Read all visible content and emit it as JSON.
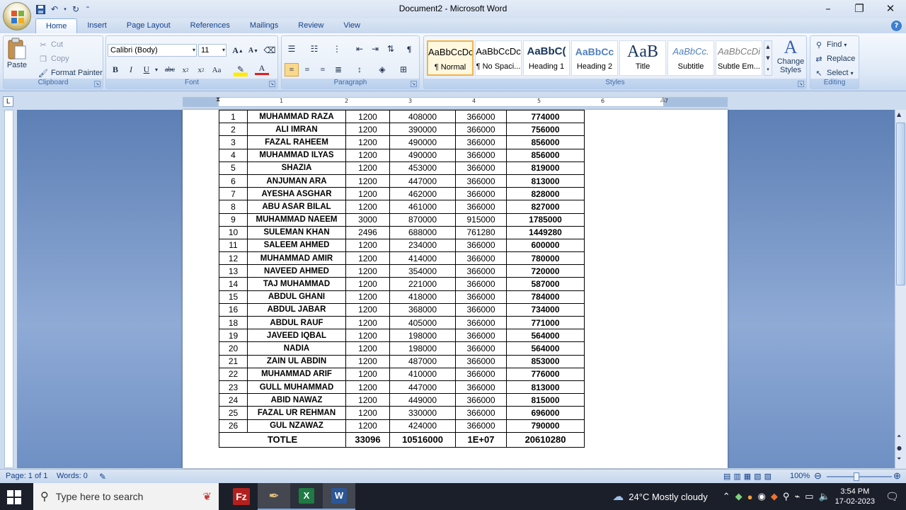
{
  "window": {
    "title": "Document2 - Microsoft Word"
  },
  "qat": {
    "save_icon": "save-icon",
    "undo_icon": "undo-icon",
    "redo_icon": "redo-icon"
  },
  "tabs": [
    {
      "label": "Home",
      "active": true
    },
    {
      "label": "Insert"
    },
    {
      "label": "Page Layout"
    },
    {
      "label": "References"
    },
    {
      "label": "Mailings"
    },
    {
      "label": "Review"
    },
    {
      "label": "View"
    }
  ],
  "clipboard": {
    "label": "Clipboard",
    "paste": "Paste",
    "cut": "Cut",
    "copy": "Copy",
    "format_painter": "Format Painter"
  },
  "font": {
    "label": "Font",
    "name": "Calibri (Body)",
    "size": "11"
  },
  "paragraph": {
    "label": "Paragraph"
  },
  "styles": {
    "label": "Styles",
    "items": [
      {
        "preview": "AaBbCcDc",
        "name": "¶ Normal"
      },
      {
        "preview": "AaBbCcDc",
        "name": "¶ No Spaci..."
      },
      {
        "preview": "AaBbC(",
        "name": "Heading 1"
      },
      {
        "preview": "AaBbCc",
        "name": "Heading 2"
      },
      {
        "preview": "AaB",
        "name": "Title"
      },
      {
        "preview": "AaBbCc.",
        "name": "Subtitle"
      },
      {
        "preview": "AaBbCcDi",
        "name": "Subtle Em..."
      }
    ],
    "change_styles": "Change Styles"
  },
  "editing": {
    "label": "Editing",
    "find": "Find",
    "replace": "Replace",
    "select": "Select"
  },
  "ruler": {
    "marks": [
      "1",
      "2",
      "3",
      "4",
      "5",
      "6",
      "7"
    ]
  },
  "table": {
    "rows": [
      [
        "1",
        "MUHAMMAD RAZA",
        "1200",
        "408000",
        "366000",
        "774000"
      ],
      [
        "2",
        "ALI IMRAN",
        "1200",
        "390000",
        "366000",
        "756000"
      ],
      [
        "3",
        "FAZAL RAHEEM",
        "1200",
        "490000",
        "366000",
        "856000"
      ],
      [
        "4",
        "MUHAMMAD ILYAS",
        "1200",
        "490000",
        "366000",
        "856000"
      ],
      [
        "5",
        "SHAZIA",
        "1200",
        "453000",
        "366000",
        "819000"
      ],
      [
        "6",
        "ANJUMAN ARA",
        "1200",
        "447000",
        "366000",
        "813000"
      ],
      [
        "7",
        "AYESHA ASGHAR",
        "1200",
        "462000",
        "366000",
        "828000"
      ],
      [
        "8",
        "ABU ASAR BILAL",
        "1200",
        "461000",
        "366000",
        "827000"
      ],
      [
        "9",
        "MUHAMMAD NAEEM",
        "3000",
        "870000",
        "915000",
        "1785000"
      ],
      [
        "10",
        "SULEMAN KHAN",
        "2496",
        "688000",
        "761280",
        "1449280"
      ],
      [
        "11",
        "SALEEM AHMED",
        "1200",
        "234000",
        "366000",
        "600000"
      ],
      [
        "12",
        "MUHAMMAD AMIR",
        "1200",
        "414000",
        "366000",
        "780000"
      ],
      [
        "13",
        "NAVEED AHMED",
        "1200",
        "354000",
        "366000",
        "720000"
      ],
      [
        "14",
        "TAJ MUHAMMAD",
        "1200",
        "221000",
        "366000",
        "587000"
      ],
      [
        "15",
        "ABDUL GHANI",
        "1200",
        "418000",
        "366000",
        "784000"
      ],
      [
        "16",
        "ABDUL JABAR",
        "1200",
        "368000",
        "366000",
        "734000"
      ],
      [
        "18",
        "ABDUL RAUF",
        "1200",
        "405000",
        "366000",
        "771000"
      ],
      [
        "19",
        "JAVEED IQBAL",
        "1200",
        "198000",
        "366000",
        "564000"
      ],
      [
        "20",
        "NADIA",
        "1200",
        "198000",
        "366000",
        "564000"
      ],
      [
        "21",
        "ZAIN UL ABDIN",
        "1200",
        "487000",
        "366000",
        "853000"
      ],
      [
        "22",
        "MUHAMMAD ARIF",
        "1200",
        "410000",
        "366000",
        "776000"
      ],
      [
        "23",
        "GULL MUHAMMAD",
        "1200",
        "447000",
        "366000",
        "813000"
      ],
      [
        "24",
        "ABID NAWAZ",
        "1200",
        "449000",
        "366000",
        "815000"
      ],
      [
        "25",
        "FAZAL UR REHMAN",
        "1200",
        "330000",
        "366000",
        "696000"
      ],
      [
        "26",
        "GUL NZAWAZ",
        "1200",
        "424000",
        "366000",
        "790000"
      ]
    ],
    "total": [
      "TOTLE",
      "33096",
      "10516000",
      "1E+07",
      "20610280"
    ]
  },
  "status": {
    "page": "Page: 1 of 1",
    "words": "Words: 0",
    "zoom": "100%"
  },
  "taskbar": {
    "search_placeholder": "Type here to search",
    "weather": "24°C  Mostly cloudy",
    "time": "3:54 PM",
    "date": "17-02-2023"
  }
}
